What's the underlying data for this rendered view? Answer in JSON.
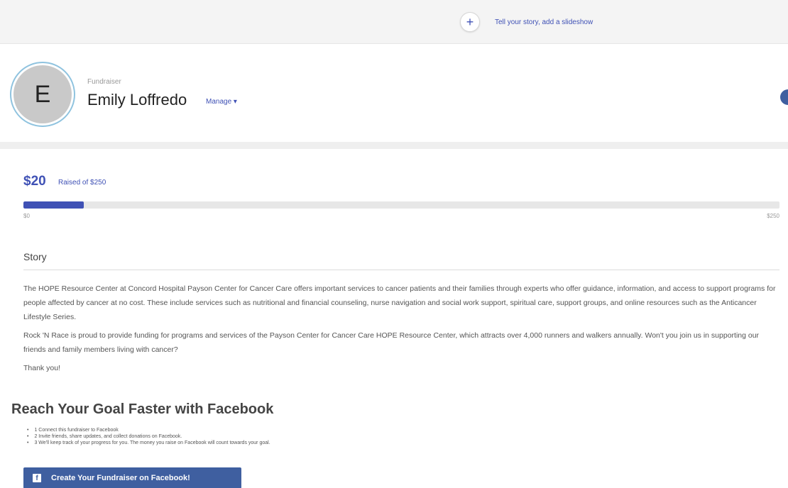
{
  "header": {
    "add_icon": "plus-icon",
    "add_story_link": "Tell your story, add a slideshow"
  },
  "profile": {
    "avatar_initial": "E",
    "role_label": "Fundraiser",
    "name": "Emily Loffredo",
    "manage_label": "Manage ▾"
  },
  "progress": {
    "raised_amount": "$20",
    "raised_of": "Raised of $250",
    "min_label": "$0",
    "max_label": "$250",
    "fraction": 0.08,
    "accent_color": "#3f51b5"
  },
  "story": {
    "heading": "Story",
    "paragraphs": [
      "The HOPE Resource Center at Concord Hospital Payson Center for Cancer Care offers important services to cancer patients and their families through experts who offer guidance, information, and access to support programs for people affected by cancer at no cost. These include services such as nutritional and financial counseling, nurse navigation and social work support, spiritual care, support groups, and online resources such as the Anticancer Lifestyle Series.",
      "Rock 'N Race is proud to provide funding for programs and services of the Payson Center for Cancer Care HOPE Resource Center, which attracts over 4,000 runners and walkers annually. Won't you join us in supporting our friends and family members living with cancer?",
      "Thank you!"
    ]
  },
  "facebook": {
    "heading": "Reach Your Goal Faster with Facebook",
    "steps": [
      "1 Connect this fundraiser to Facebook",
      "2 Invite friends, share updates, and collect donations on Facebook.",
      "3 We'll keep track of your progress for you. The money you raise on Facebook will count towards your goal."
    ],
    "button_icon": "facebook-icon",
    "button_label": "Create Your Fundraiser on Facebook!",
    "brand_color": "#3f5fa0"
  }
}
